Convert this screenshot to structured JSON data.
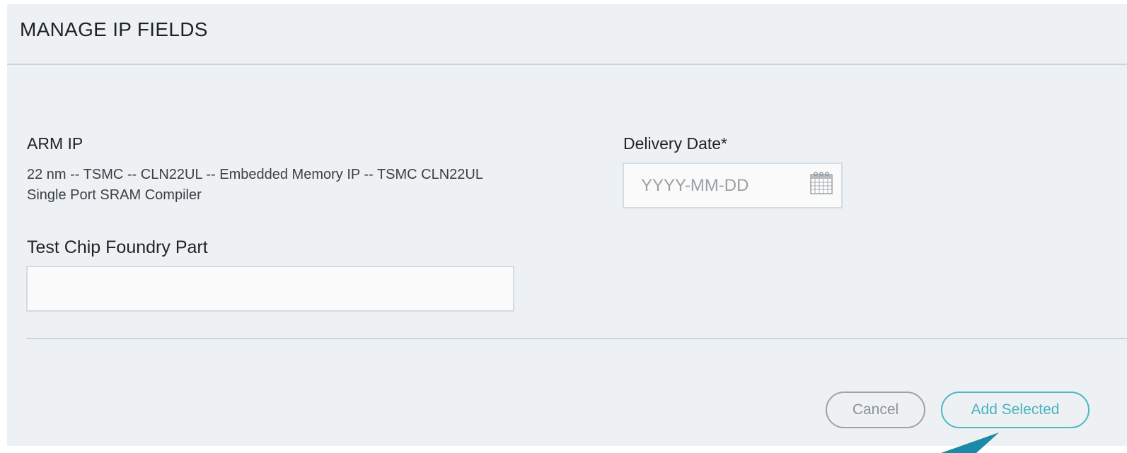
{
  "modal": {
    "title": "MANAGE IP FIELDS"
  },
  "arm_ip": {
    "label": "ARM IP",
    "description": "22 nm -- TSMC -- CLN22UL -- Embedded Memory IP -- TSMC CLN22UL Single Port SRAM Compiler"
  },
  "delivery_date": {
    "label": "Delivery Date*",
    "placeholder": "YYYY-MM-DD",
    "value": "",
    "icon": "calendar-icon"
  },
  "test_chip": {
    "label": "Test Chip Foundry Part",
    "value": ""
  },
  "buttons": {
    "cancel_label": "Cancel",
    "add_selected_label": "Add Selected"
  },
  "colors": {
    "modal_background": "#edf1f4",
    "accent": "#4ab3bf",
    "cursor_arrow": "#1a8aa8"
  }
}
